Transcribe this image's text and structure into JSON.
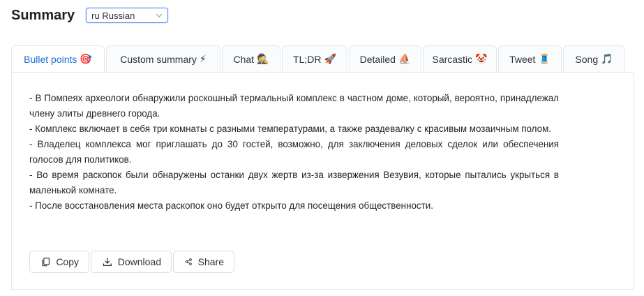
{
  "header": {
    "title": "Summary",
    "language": {
      "selected": "ru Russian"
    }
  },
  "tabs": [
    {
      "label": "Bullet points",
      "emoji": "🎯",
      "active": true
    },
    {
      "label": "Custom summary",
      "emoji": "⚡",
      "active": false
    },
    {
      "label": "Chat",
      "emoji": "🕵",
      "active": false
    },
    {
      "label": "TL;DR",
      "emoji": "🚀",
      "active": false
    },
    {
      "label": "Detailed",
      "emoji": "⛵",
      "active": false
    },
    {
      "label": "Sarcastic",
      "emoji": "🤡",
      "active": false
    },
    {
      "label": "Tweet",
      "emoji": "🧵",
      "active": false
    },
    {
      "label": "Song",
      "emoji": "🎵",
      "active": false
    }
  ],
  "summary": {
    "bullets": [
      "- В Помпеях археологи обнаружили роскошный термальный комплекс в частном доме, который, вероятно, принадлежал члену элиты древнего города.",
      "- Комплекс включает в себя три комнаты с разными температурами, а также раздевалку с красивым мозаичным полом.",
      "- Владелец комплекса мог приглашать до 30 гостей, возможно, для заключения деловых сделок или обеспечения голосов для политиков.",
      "- Во время раскопок были обнаружены останки двух жертв из-за извержения Везувия, которые пытались укрыться в маленькой комнате.",
      "- После восстановления места раскопок оно будет открыто для посещения общественности."
    ]
  },
  "actions": {
    "copy_label": "Copy",
    "download_label": "Download",
    "share_label": "Share"
  },
  "colors": {
    "accent": "#1a6ed8",
    "border": "#e6e8eb"
  }
}
